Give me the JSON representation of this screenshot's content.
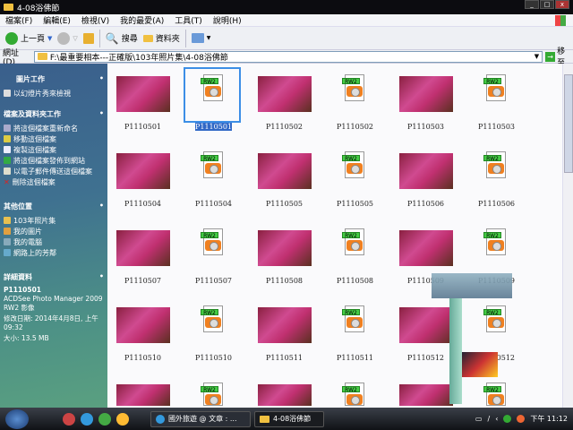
{
  "window": {
    "title": "4-08浴佛節"
  },
  "menu": [
    "檔案(F)",
    "編輯(E)",
    "檢視(V)",
    "我的最愛(A)",
    "工具(T)",
    "說明(H)"
  ],
  "toolbar": {
    "back": "上一頁",
    "search": "搜尋",
    "folders": "資料夾"
  },
  "address": {
    "label": "網址(D)",
    "value": "F:\\最重要相本---正確版\\103年照片集\\4-08浴佛節",
    "go": "移至"
  },
  "sidebar": {
    "picture_tasks": {
      "title": "圖片工作",
      "items": [
        "以幻燈片秀來檢視"
      ]
    },
    "file_tasks": {
      "title": "檔案及資料夾工作",
      "items": [
        "將這個檔案重新命名",
        "移動這個檔案",
        "複製這個檔案",
        "將這個檔案發佈到網站",
        "以電子郵件傳送這個檔案",
        "刪除這個檔案"
      ]
    },
    "other_places": {
      "title": "其他位置",
      "items": [
        "103年照片集",
        "我的圖片",
        "我的電腦",
        "網路上的芳鄰"
      ]
    },
    "details": {
      "title": "詳細資料",
      "name": "P1110501",
      "type": "ACDSee Photo Manager 2009 RW2 影像",
      "modified": "修改日期: 2014年4月8日, 上午 09:32",
      "size": "大小: 13.5 MB"
    }
  },
  "files": [
    {
      "name": "P1110501",
      "kind": "jpg"
    },
    {
      "name": "P1110501",
      "kind": "rw2",
      "selected": true
    },
    {
      "name": "P1110502",
      "kind": "jpg"
    },
    {
      "name": "P1110502",
      "kind": "rw2"
    },
    {
      "name": "P1110503",
      "kind": "jpg"
    },
    {
      "name": "P1110503",
      "kind": "rw2"
    },
    {
      "name": "P1110504",
      "kind": "jpg"
    },
    {
      "name": "P1110504",
      "kind": "rw2"
    },
    {
      "name": "P1110505",
      "kind": "jpg"
    },
    {
      "name": "P1110505",
      "kind": "rw2"
    },
    {
      "name": "P1110506",
      "kind": "jpg"
    },
    {
      "name": "P1110506",
      "kind": "rw2"
    },
    {
      "name": "P1110507",
      "kind": "jpg"
    },
    {
      "name": "P1110507",
      "kind": "rw2"
    },
    {
      "name": "P1110508",
      "kind": "jpg"
    },
    {
      "name": "P1110508",
      "kind": "rw2"
    },
    {
      "name": "P1110509",
      "kind": "jpg"
    },
    {
      "name": "P1110509",
      "kind": "rw2"
    },
    {
      "name": "P1110510",
      "kind": "jpg"
    },
    {
      "name": "P1110510",
      "kind": "rw2"
    },
    {
      "name": "P1110511",
      "kind": "jpg"
    },
    {
      "name": "P1110511",
      "kind": "rw2"
    },
    {
      "name": "P1110512",
      "kind": "jpg"
    },
    {
      "name": "P1110512",
      "kind": "rw2"
    },
    {
      "name": "",
      "kind": "jpg"
    },
    {
      "name": "",
      "kind": "rw2"
    },
    {
      "name": "",
      "kind": "jpg"
    },
    {
      "name": "",
      "kind": "rw2"
    },
    {
      "name": "",
      "kind": "jpg"
    },
    {
      "name": "",
      "kind": "rw2"
    }
  ],
  "rw2_tag": "RW2",
  "taskbar": {
    "tasks": [
      "國外旅遊 @ 文章 : ...",
      "4-08浴佛節"
    ],
    "clock": "下午 11:12"
  }
}
